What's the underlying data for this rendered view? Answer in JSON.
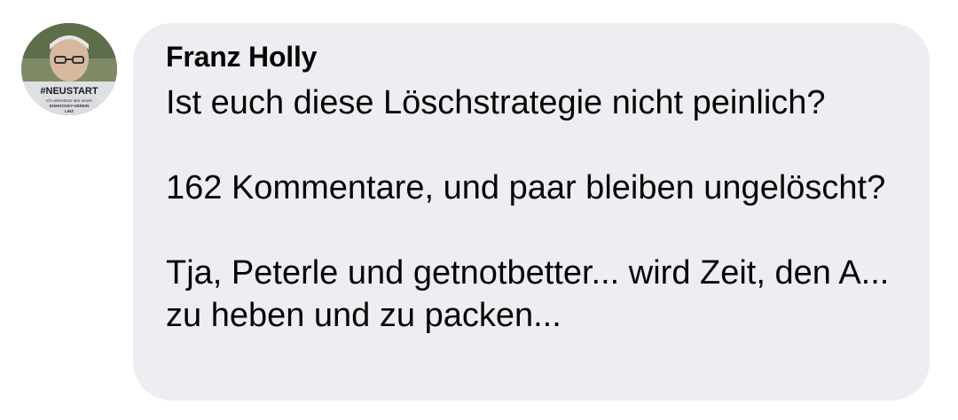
{
  "comment": {
    "author": "Franz Holly",
    "text": "Ist euch diese Löschstrategie nicht peinlich?\n\n162 Kommentare, und paar bleiben ungelöscht?\n\nTja, Peterle und getnotbetter... wird Zeit, den A... zu heben und zu packen...",
    "avatar_badge": "#NEUSTART",
    "avatar_caption_1": "Ich unterstütze den neuen",
    "avatar_caption_2": "EISHOCKEY-VEREIN",
    "avatar_caption_3": "LINZ"
  },
  "colors": {
    "bubble": "#eceef1",
    "text": "#050505",
    "muted": "#8a8d91"
  }
}
